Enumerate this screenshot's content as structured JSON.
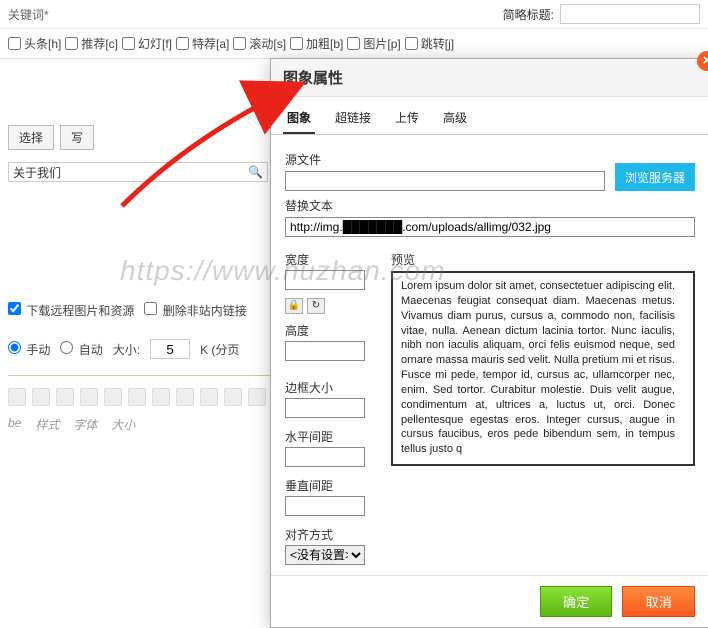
{
  "bg": {
    "keyword_label": "关键词*",
    "short_title_label": "简略标题:",
    "flags": [
      "头条[h]",
      "推荐[c]",
      "幻灯[f]",
      "特荐[a]",
      "滚动[s]",
      "加粗[b]",
      "图片[p]",
      "跳转[j]"
    ],
    "keyword_buttons": {
      "select": "选择",
      "write": "写"
    },
    "summary_value": "关于我们",
    "opt_remote": "下载远程图片和资源",
    "opt_remove_link": "删除非站内链接",
    "opt_manual": "手动",
    "opt_auto": "自动",
    "size_label": "大小:",
    "size_value": "5",
    "size_unit": "K (分页",
    "row2": [
      "be",
      "样式",
      "字体",
      "大小"
    ]
  },
  "dialog": {
    "title": "图象属性",
    "tabs": [
      "图象",
      "超链接",
      "上传",
      "高级"
    ],
    "source_label": "源文件",
    "browse_btn": "浏览服务器",
    "alt_label": "替换文本",
    "alt_value": "http://img.███████.com/uploads/allimg/032.jpg",
    "width_label": "宽度",
    "height_label": "高度",
    "border_label": "边框大小",
    "hspace_label": "水平间距",
    "vspace_label": "垂直间距",
    "align_label": "对齐方式",
    "align_value": "<没有设置>",
    "preview_label": "预览",
    "preview_text": "Lorem ipsum dolor sit amet, consectetuer adipiscing elit. Maecenas feugiat consequat diam. Maecenas metus. Vivamus diam purus, cursus a, commodo non, facilisis vitae, nulla. Aenean dictum lacinia tortor. Nunc iaculis, nibh non iaculis aliquam, orci felis euismod neque, sed ornare massa mauris sed velit. Nulla pretium mi et risus. Fusce mi pede, tempor id, cursus ac, ullamcorper nec, enim. Sed tortor. Curabitur molestie. Duis velit augue, condimentum at, ultrices a, luctus ut, orci. Donec pellentesque egestas eros. Integer cursus, augue in cursus faucibus, eros pede bibendum sem, in tempus tellus justo q",
    "ok": "确定",
    "cancel": "取消"
  },
  "watermark": "https://www.huzhan.com"
}
